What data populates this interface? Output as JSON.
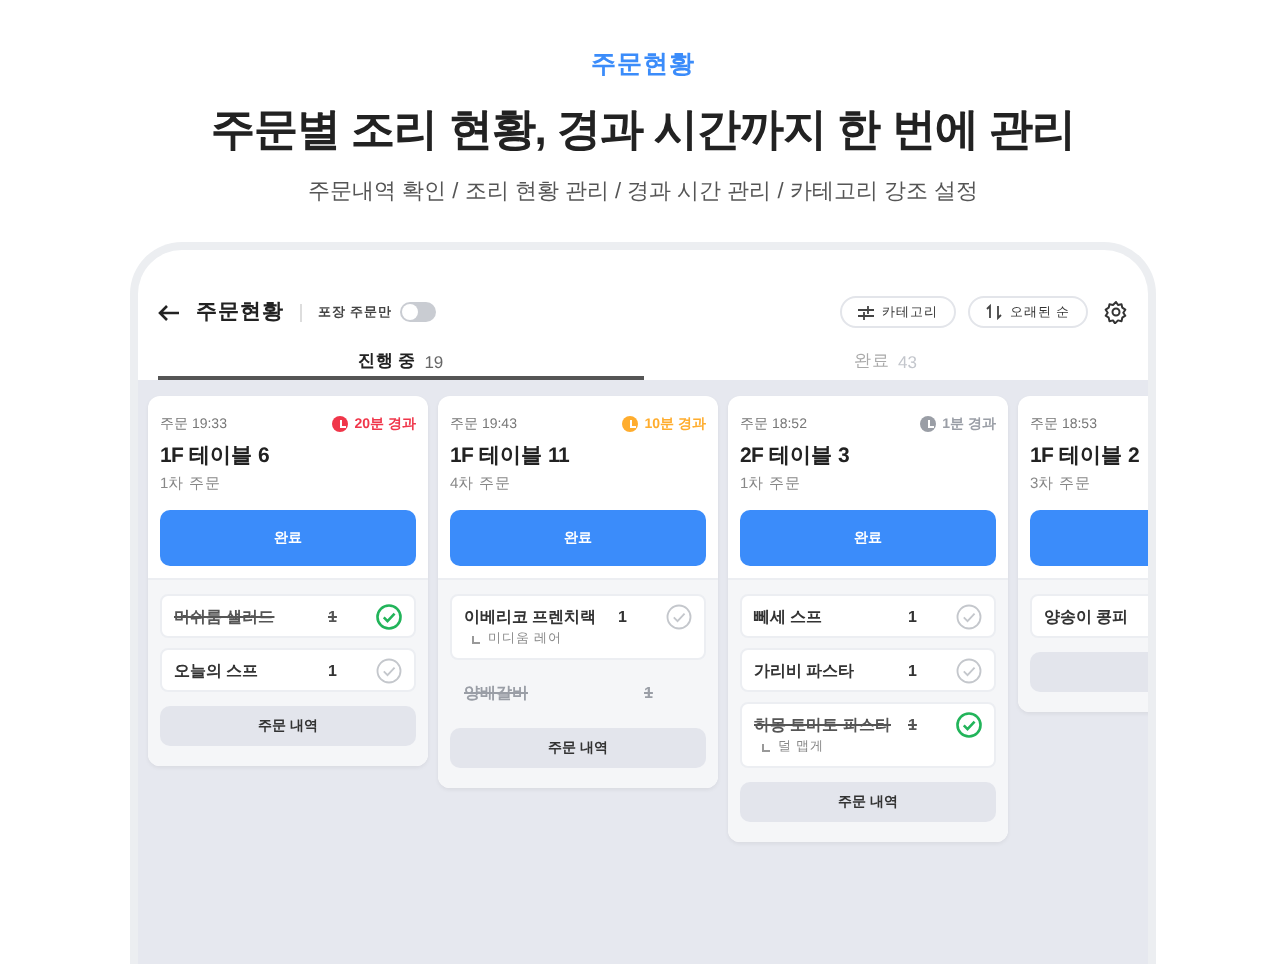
{
  "hero": {
    "eyebrow": "주문현황",
    "title": "주문별 조리 현황, 경과 시간까지 한 번에 관리",
    "subtitle": "주문내역 확인 / 조리 현황 관리 / 경과 시간 관리 / 카테고리 강조 설정"
  },
  "toolbar": {
    "title": "주문현황",
    "toggle_label": "포장 주문만",
    "packaging_only": false,
    "buttons": [
      {
        "kind": "filter",
        "label": "카테고리"
      },
      {
        "kind": "sort",
        "label": "오래된 순"
      }
    ]
  },
  "tabs": [
    {
      "label": "진행 중",
      "count": "19",
      "selected": true
    },
    {
      "label": "완료",
      "count": "43",
      "selected": false
    }
  ],
  "cards": [
    {
      "time": "주문 19:33",
      "elapsed": "20분 경과",
      "color": "#f0364a",
      "table": "1F 테이블 6",
      "round": "1차 주문",
      "done_label": "완료",
      "details_label": "주문 내역",
      "items": [
        {
          "name": "머쉬룸 샐러드",
          "qty": "1",
          "checked": true,
          "canceled": false
        },
        {
          "name": "오늘의 스프",
          "qty": "1",
          "checked": false,
          "canceled": false
        }
      ]
    },
    {
      "time": "주문 19:43",
      "elapsed": "10분 경과",
      "color": "#ffad2e",
      "table": "1F 테이블 11",
      "round": "4차 주문",
      "done_label": "완료",
      "details_label": "주문 내역",
      "items": [
        {
          "name": "이베리코 프렌치랙",
          "qty": "1",
          "checked": false,
          "canceled": false,
          "option": "미디움 레어"
        },
        {
          "name": "양배갈비",
          "qty": "1",
          "canceled": true
        }
      ]
    },
    {
      "time": "주문 18:52",
      "elapsed": "1분 경과",
      "color": "#9a9ea6",
      "table": "2F 테이블 3",
      "round": "1차 주문",
      "done_label": "완료",
      "details_label": "주문 내역",
      "items": [
        {
          "name": "뻬세 스프",
          "qty": "1",
          "checked": false,
          "canceled": false
        },
        {
          "name": "가리비 파스타",
          "qty": "1",
          "checked": false,
          "canceled": false
        },
        {
          "name": "하몽 토마토 파스타",
          "qty": "1",
          "checked": true,
          "canceled": false,
          "option": "덜 맵게"
        }
      ]
    },
    {
      "time": "주문 18:53",
      "table": "1F 테이블 2",
      "round": "3차 주문",
      "items": [
        {
          "name": "양송이 콩피",
          "canceled": false
        }
      ]
    }
  ]
}
